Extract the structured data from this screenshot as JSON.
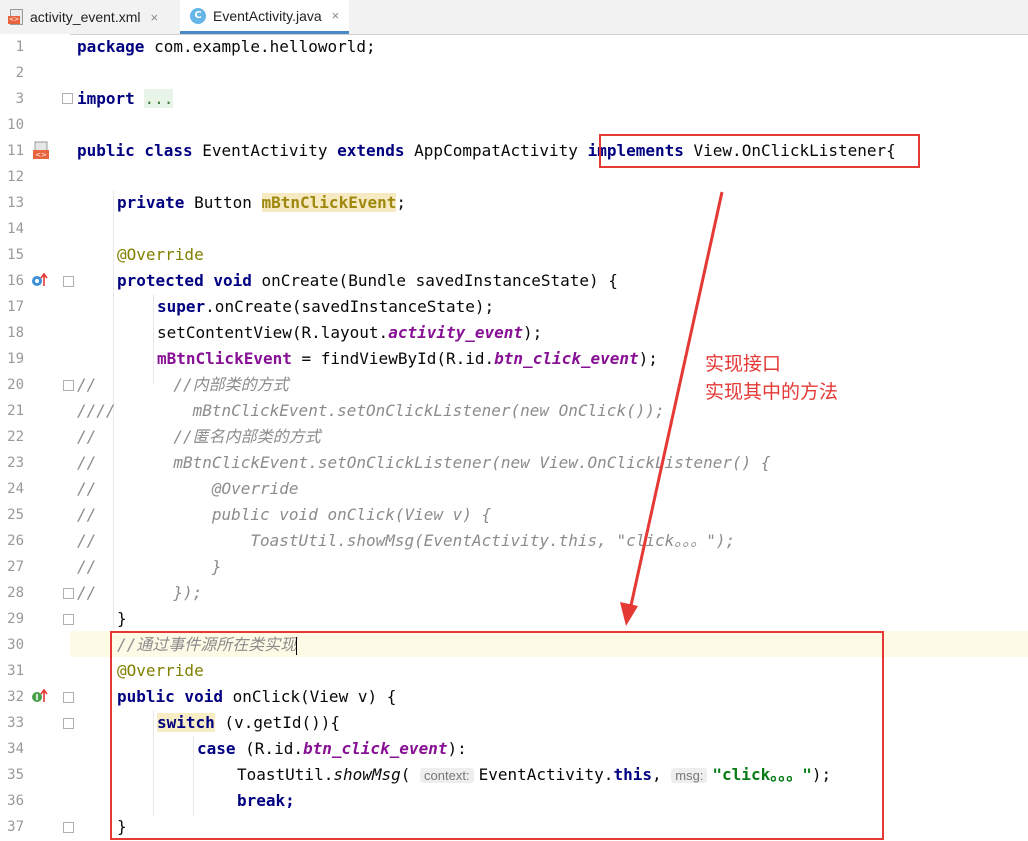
{
  "tabs": [
    {
      "label": "activity_event.xml",
      "icon": "xml-file-icon",
      "active": false
    },
    {
      "label": "EventActivity.java",
      "icon": "java-class-icon",
      "active": true
    }
  ],
  "tab_close_glyph": "×",
  "inlay_hints": {
    "context": "context:",
    "msg": "msg:"
  },
  "annotations": {
    "note_line1": "实现接口",
    "note_line2": "实现其中的方法",
    "color": "#e53935"
  },
  "editor": {
    "current_line": 30,
    "line_numbers": [
      "1",
      "2",
      "3",
      "10",
      "11",
      "12",
      "13",
      "14",
      "15",
      "16",
      "17",
      "18",
      "19",
      "20",
      "21",
      "22",
      "23",
      "24",
      "25",
      "26",
      "27",
      "28",
      "29",
      "30",
      "31",
      "32",
      "33",
      "34",
      "35",
      "36",
      "37"
    ],
    "code": {
      "l1_kw": "package",
      "l1_rest": " com.example.helloworld;",
      "l3_kw": "import",
      "l3_fold": "...",
      "l11_a": "public class",
      "l11_b": " EventActivity ",
      "l11_c": "extends",
      "l11_d": " AppCompatActivity ",
      "l11_e": "implements",
      "l11_f": " View.OnClickListener{",
      "l13_a": "private",
      "l13_b": " Button ",
      "l13_c": "mBtnClickEvent",
      "l13_d": ";",
      "l15": "@Override",
      "l16_a": "protected void",
      "l16_b": " onCreate(Bundle savedInstanceState) {",
      "l17_a": "super",
      "l17_b": ".onCreate(savedInstanceState);",
      "l18_a": "setContentView(R.layout.",
      "l18_b": "activity_event",
      "l18_c": ");",
      "l19_a": "mBtnClickEvent",
      "l19_b": " = findViewById(R.id.",
      "l19_c": "btn_click_event",
      "l19_d": ");",
      "l20": "//        //内部类的方式",
      "l21": "////        mBtnClickEvent.setOnClickListener(new OnClick());",
      "l22": "//        //匿名内部类的方式",
      "l23": "//        mBtnClickEvent.setOnClickListener(new View.OnClickListener() {",
      "l24": "//            @Override",
      "l25": "//            public void onClick(View v) {",
      "l26": "//                ToastUtil.showMsg(EventActivity.this, \"click。。。\");",
      "l27": "//            }",
      "l28": "//        });",
      "l29": "}",
      "l30": "//通过事件源所在类实现",
      "l31": "@Override",
      "l32_a": "public void",
      "l32_b": " onClick(View v) {",
      "l33_a": "switch",
      "l33_b": " (v.getId()){",
      "l34_a": "case",
      "l34_b": " (R.id.",
      "l34_c": "btn_click_event",
      "l34_d": "):",
      "l35_a": "ToastUtil.",
      "l35_b": "showMsg",
      "l35_c": "(",
      "l35_d": "EventActivity.",
      "l35_e": "this",
      "l35_f": ", ",
      "l35_g": "\"click。。。\"",
      "l35_h": ");",
      "l36": "break;",
      "l37": "}"
    }
  }
}
